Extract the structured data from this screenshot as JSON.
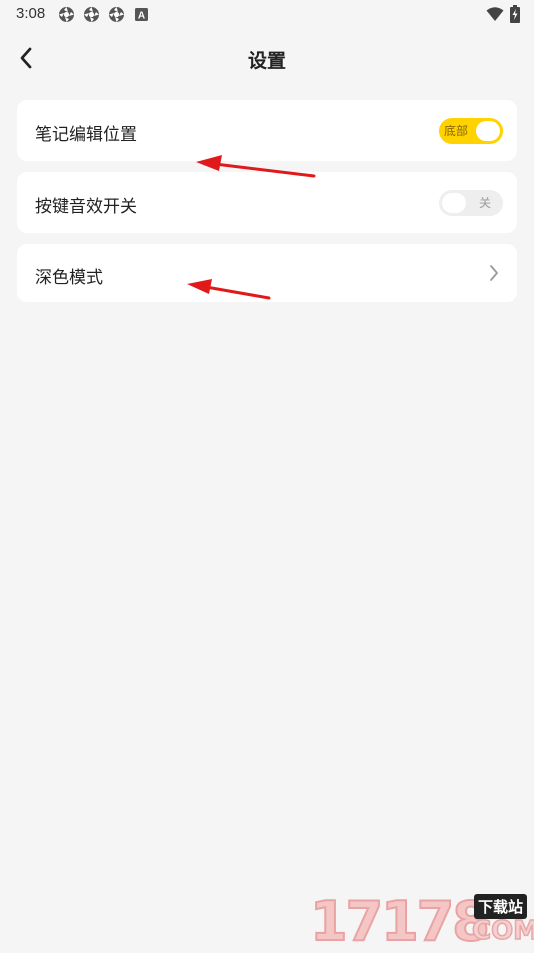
{
  "status_bar": {
    "time": "3:08",
    "left_icons": [
      "notification-icon",
      "notification-icon",
      "notification-icon",
      "a-icon"
    ],
    "a_icon_letter": "A",
    "right_icons": [
      "wifi-icon",
      "battery-icon"
    ]
  },
  "nav": {
    "title": "设置",
    "back_icon": "chevron-left-icon"
  },
  "settings": [
    {
      "label": "笔记编辑位置",
      "control": "toggle",
      "state": "on",
      "toggle_text": "底部"
    },
    {
      "label": "按键音效开关",
      "control": "toggle",
      "state": "off",
      "toggle_text": "关"
    },
    {
      "label": "深色模式",
      "control": "chevron",
      "chevron_icon": "chevron-right-icon"
    }
  ],
  "watermark": {
    "number": "17178",
    "tag": "下载站",
    "domain": "COM"
  },
  "colors": {
    "background": "#f5f5f5",
    "card": "#ffffff",
    "accent_yellow": "#ffd200",
    "annotation_red": "#e01a1a"
  }
}
